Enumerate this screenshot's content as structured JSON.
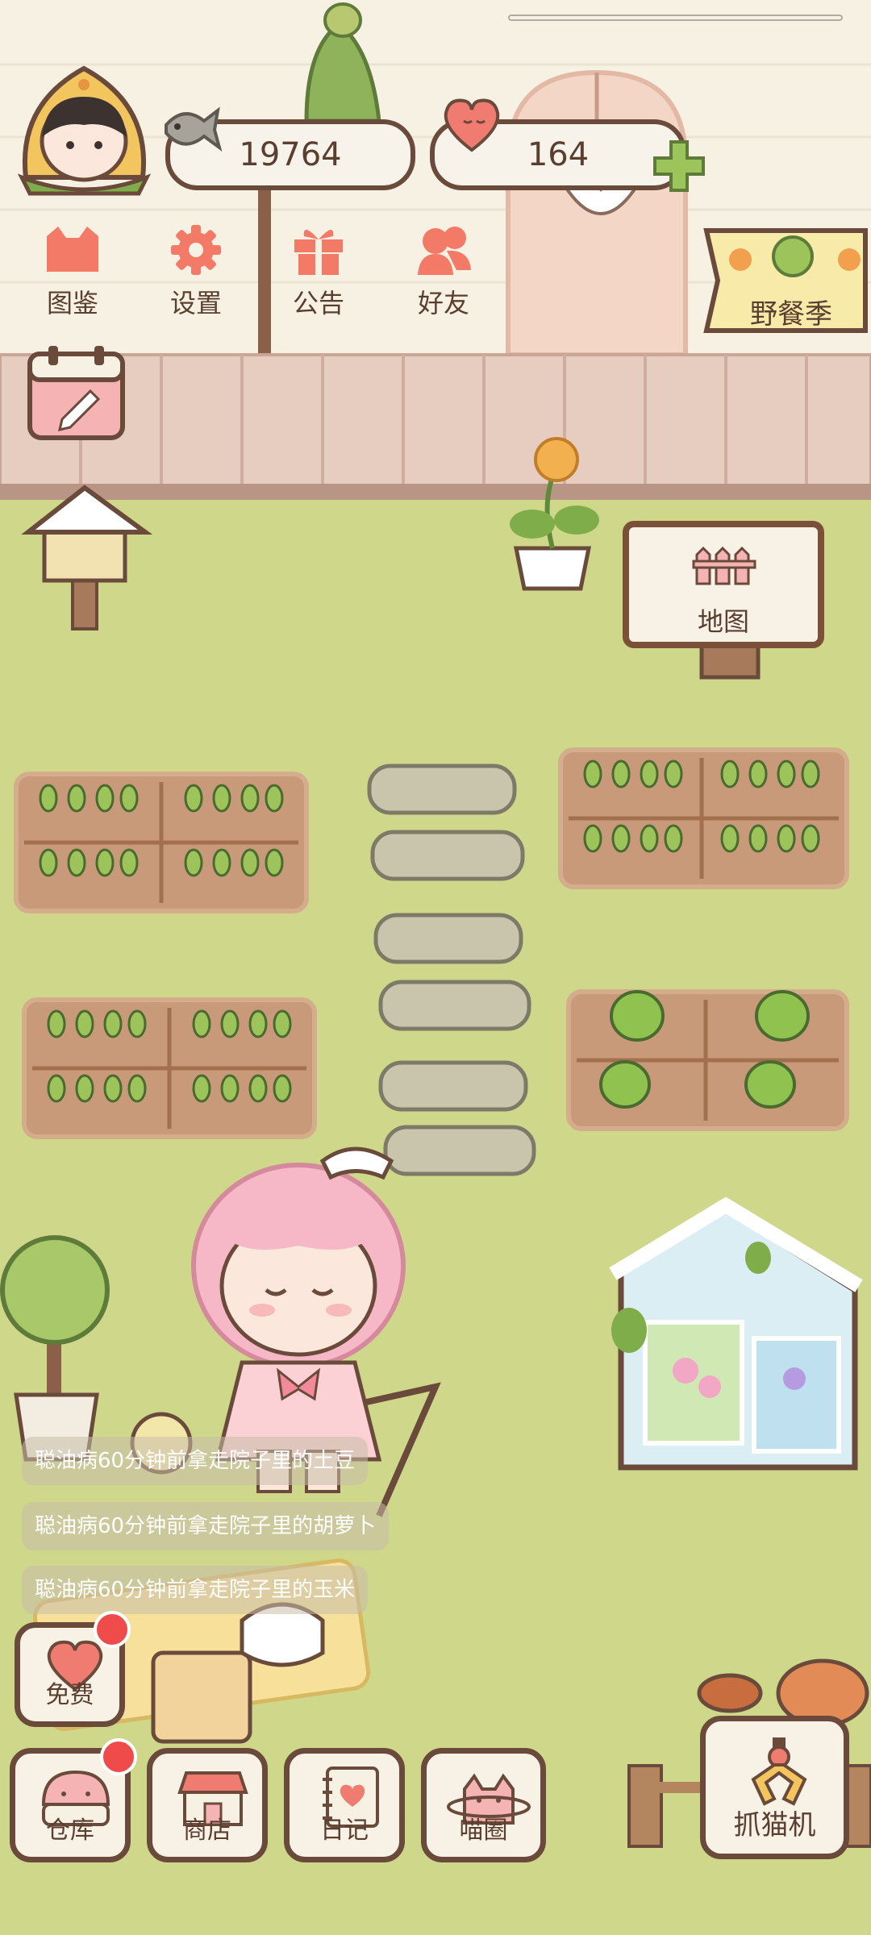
{
  "currency": {
    "fish_amount": "19764",
    "heart_amount": "164"
  },
  "top_menu": [
    {
      "label": "图鉴",
      "icon": "cat-face-icon"
    },
    {
      "label": "设置",
      "icon": "gear-icon"
    },
    {
      "label": "公告",
      "icon": "gift-icon"
    },
    {
      "label": "好友",
      "icon": "friends-icon"
    }
  ],
  "event_banner": {
    "label": "野餐季"
  },
  "map_sign": {
    "label": "地图"
  },
  "feed_messages": [
    "聪油病60分钟前拿走院子里的土豆",
    "聪油病60分钟前拿走院子里的胡萝卜",
    "聪油病60分钟前拿走院子里的玉米"
  ],
  "free_button": {
    "label": "免费"
  },
  "bottom_nav": [
    {
      "label": "仓库",
      "icon": "warehouse-icon"
    },
    {
      "label": "商店",
      "icon": "shop-icon"
    },
    {
      "label": "日记",
      "icon": "diary-icon"
    },
    {
      "label": "喵圈",
      "icon": "cat-planet-icon"
    }
  ],
  "claw_machine": {
    "label": "抓猫机"
  },
  "colors": {
    "grass": "#cfd88a",
    "wall": "#f6f1e3",
    "fence": "#e7cdbf",
    "outline": "#6a4a3a",
    "accent_red": "#f04b4b"
  }
}
